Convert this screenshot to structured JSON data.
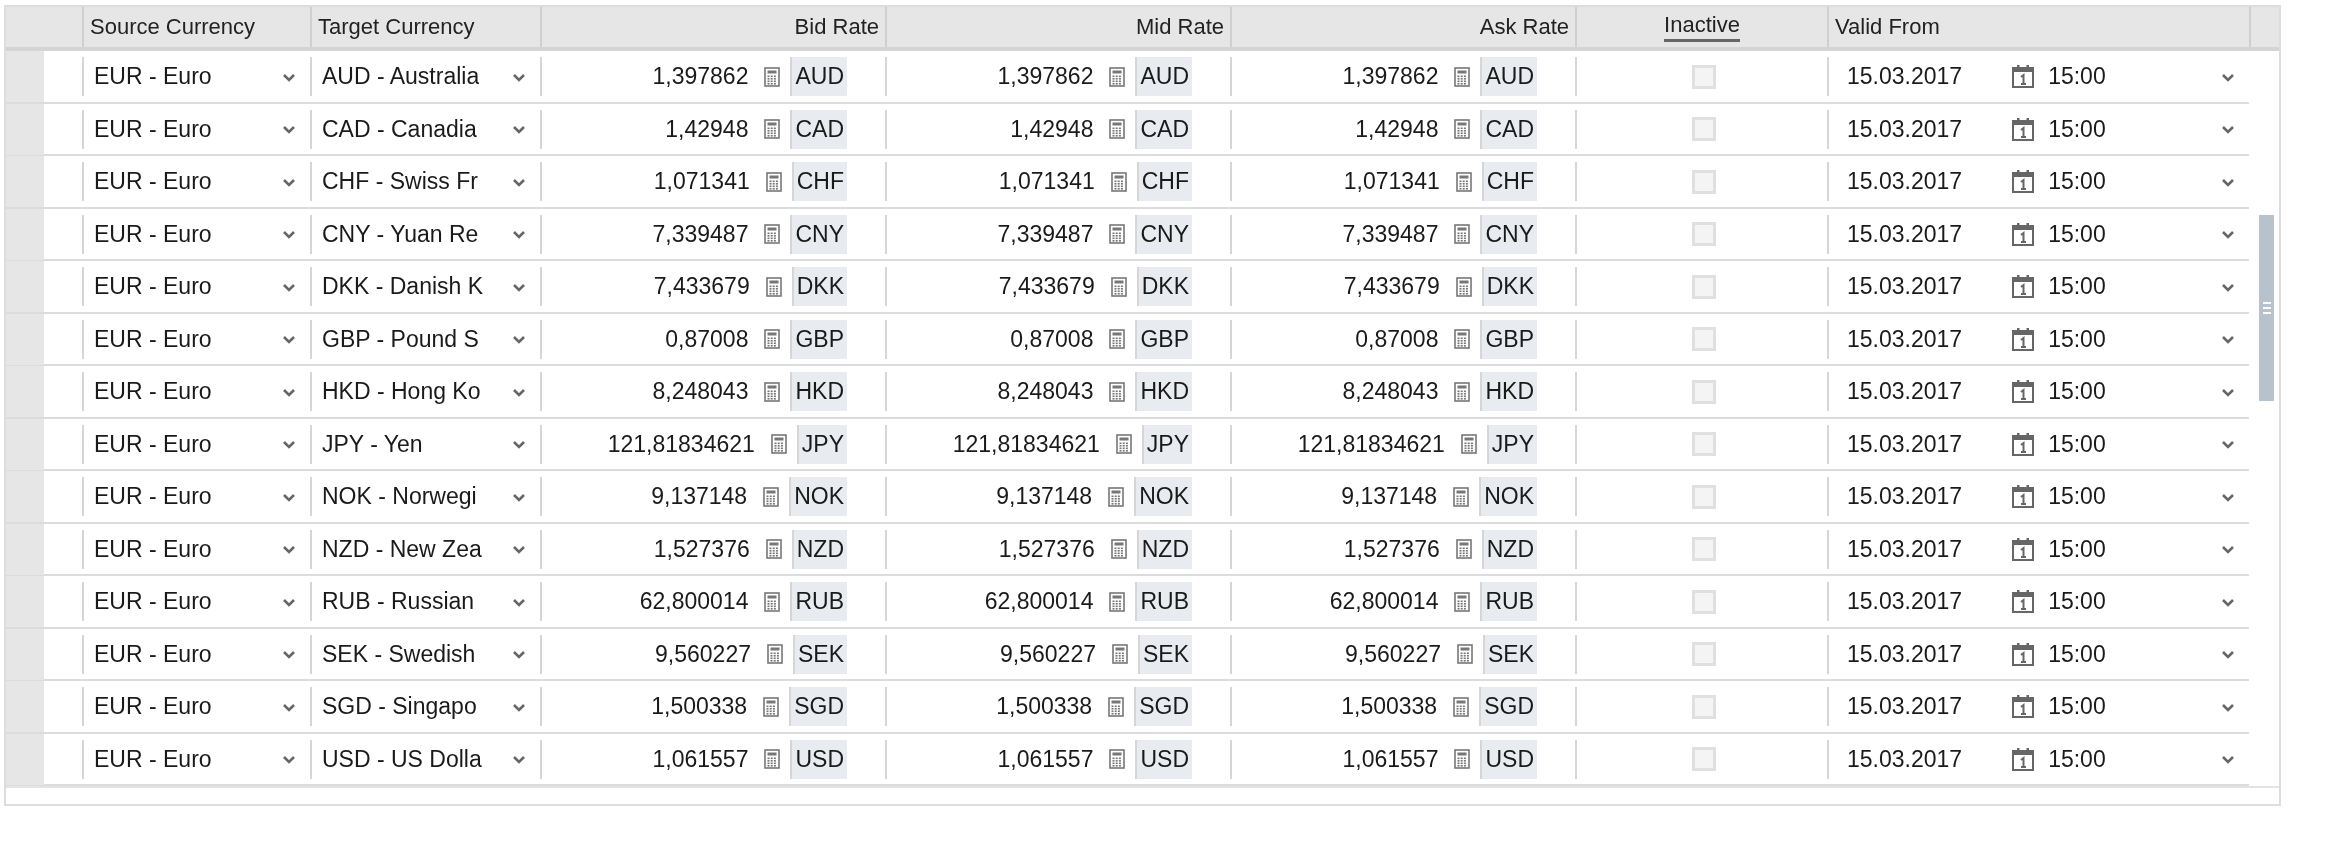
{
  "table": {
    "columns": [
      {
        "label": "Source Currency",
        "kind": "select"
      },
      {
        "label": "Target Currency",
        "kind": "select"
      },
      {
        "label": "Bid Rate",
        "kind": "rate"
      },
      {
        "label": "Mid Rate",
        "kind": "rate"
      },
      {
        "label": "Ask Rate",
        "kind": "rate"
      },
      {
        "label": "Inactive",
        "kind": "check"
      },
      {
        "label": "Valid From",
        "kind": "datetime"
      }
    ],
    "rows": [
      {
        "source": "EUR - Euro",
        "target": "AUD - Australia",
        "bid": {
          "value": "1,397862",
          "currency": "AUD"
        },
        "mid": {
          "value": "1,397862",
          "currency": "AUD"
        },
        "ask": {
          "value": "1,397862",
          "currency": "AUD"
        },
        "inactive": false,
        "valid_date": "15.03.2017",
        "valid_time": "15:00"
      },
      {
        "source": "EUR - Euro",
        "target": "CAD - Canadia",
        "bid": {
          "value": "1,42948",
          "currency": "CAD"
        },
        "mid": {
          "value": "1,42948",
          "currency": "CAD"
        },
        "ask": {
          "value": "1,42948",
          "currency": "CAD"
        },
        "inactive": false,
        "valid_date": "15.03.2017",
        "valid_time": "15:00"
      },
      {
        "source": "EUR - Euro",
        "target": "CHF - Swiss Fr",
        "bid": {
          "value": "1,071341",
          "currency": "CHF"
        },
        "mid": {
          "value": "1,071341",
          "currency": "CHF"
        },
        "ask": {
          "value": "1,071341",
          "currency": "CHF"
        },
        "inactive": false,
        "valid_date": "15.03.2017",
        "valid_time": "15:00"
      },
      {
        "source": "EUR - Euro",
        "target": "CNY - Yuan Re",
        "bid": {
          "value": "7,339487",
          "currency": "CNY"
        },
        "mid": {
          "value": "7,339487",
          "currency": "CNY"
        },
        "ask": {
          "value": "7,339487",
          "currency": "CNY"
        },
        "inactive": false,
        "valid_date": "15.03.2017",
        "valid_time": "15:00"
      },
      {
        "source": "EUR - Euro",
        "target": "DKK - Danish K",
        "bid": {
          "value": "7,433679",
          "currency": "DKK"
        },
        "mid": {
          "value": "7,433679",
          "currency": "DKK"
        },
        "ask": {
          "value": "7,433679",
          "currency": "DKK"
        },
        "inactive": false,
        "valid_date": "15.03.2017",
        "valid_time": "15:00"
      },
      {
        "source": "EUR - Euro",
        "target": "GBP - Pound S",
        "bid": {
          "value": "0,87008",
          "currency": "GBP"
        },
        "mid": {
          "value": "0,87008",
          "currency": "GBP"
        },
        "ask": {
          "value": "0,87008",
          "currency": "GBP"
        },
        "inactive": false,
        "valid_date": "15.03.2017",
        "valid_time": "15:00"
      },
      {
        "source": "EUR - Euro",
        "target": "HKD - Hong Ko",
        "bid": {
          "value": "8,248043",
          "currency": "HKD"
        },
        "mid": {
          "value": "8,248043",
          "currency": "HKD"
        },
        "ask": {
          "value": "8,248043",
          "currency": "HKD"
        },
        "inactive": false,
        "valid_date": "15.03.2017",
        "valid_time": "15:00"
      },
      {
        "source": "EUR - Euro",
        "target": "JPY - Yen",
        "bid": {
          "value": "121,81834621",
          "currency": "JPY"
        },
        "mid": {
          "value": "121,81834621",
          "currency": "JPY"
        },
        "ask": {
          "value": "121,81834621",
          "currency": "JPY"
        },
        "inactive": false,
        "valid_date": "15.03.2017",
        "valid_time": "15:00"
      },
      {
        "source": "EUR - Euro",
        "target": "NOK - Norwegi",
        "bid": {
          "value": "9,137148",
          "currency": "NOK"
        },
        "mid": {
          "value": "9,137148",
          "currency": "NOK"
        },
        "ask": {
          "value": "9,137148",
          "currency": "NOK"
        },
        "inactive": false,
        "valid_date": "15.03.2017",
        "valid_time": "15:00"
      },
      {
        "source": "EUR - Euro",
        "target": "NZD - New Zea",
        "bid": {
          "value": "1,527376",
          "currency": "NZD"
        },
        "mid": {
          "value": "1,527376",
          "currency": "NZD"
        },
        "ask": {
          "value": "1,527376",
          "currency": "NZD"
        },
        "inactive": false,
        "valid_date": "15.03.2017",
        "valid_time": "15:00"
      },
      {
        "source": "EUR - Euro",
        "target": "RUB - Russian",
        "bid": {
          "value": "62,800014",
          "currency": "RUB"
        },
        "mid": {
          "value": "62,800014",
          "currency": "RUB"
        },
        "ask": {
          "value": "62,800014",
          "currency": "RUB"
        },
        "inactive": false,
        "valid_date": "15.03.2017",
        "valid_time": "15:00"
      },
      {
        "source": "EUR - Euro",
        "target": "SEK - Swedish",
        "bid": {
          "value": "9,560227",
          "currency": "SEK"
        },
        "mid": {
          "value": "9,560227",
          "currency": "SEK"
        },
        "ask": {
          "value": "9,560227",
          "currency": "SEK"
        },
        "inactive": false,
        "valid_date": "15.03.2017",
        "valid_time": "15:00"
      },
      {
        "source": "EUR - Euro",
        "target": "SGD - Singapo",
        "bid": {
          "value": "1,500338",
          "currency": "SGD"
        },
        "mid": {
          "value": "1,500338",
          "currency": "SGD"
        },
        "ask": {
          "value": "1,500338",
          "currency": "SGD"
        },
        "inactive": false,
        "valid_date": "15.03.2017",
        "valid_time": "15:00"
      },
      {
        "source": "EUR - Euro",
        "target": "USD - US Dolla",
        "bid": {
          "value": "1,061557",
          "currency": "USD"
        },
        "mid": {
          "value": "1,061557",
          "currency": "USD"
        },
        "ask": {
          "value": "1,061557",
          "currency": "USD"
        },
        "inactive": false,
        "valid_date": "15.03.2017",
        "valid_time": "15:00"
      }
    ]
  }
}
